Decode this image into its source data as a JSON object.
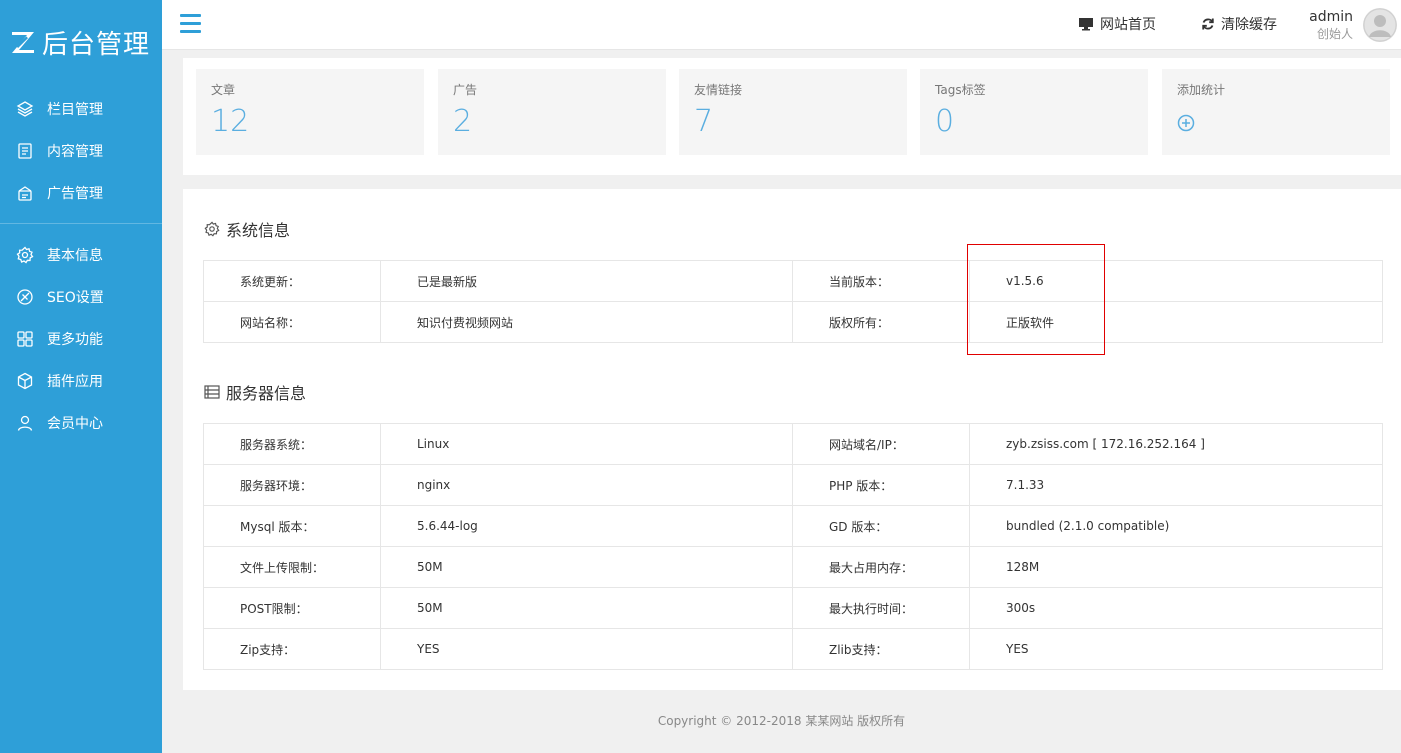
{
  "sidebar": {
    "logo_text": "后台管理",
    "groups": [
      [
        {
          "label": "栏目管理",
          "icon": "layers-icon"
        },
        {
          "label": "内容管理",
          "icon": "document-icon"
        },
        {
          "label": "广告管理",
          "icon": "ad-icon"
        }
      ],
      [
        {
          "label": "基本信息",
          "icon": "gear-icon"
        },
        {
          "label": "SEO设置",
          "icon": "seo-icon"
        },
        {
          "label": "更多功能",
          "icon": "grid-icon"
        },
        {
          "label": "插件应用",
          "icon": "cube-icon"
        },
        {
          "label": "会员中心",
          "icon": "user-icon"
        }
      ]
    ]
  },
  "header": {
    "site_home": "网站首页",
    "clear_cache": "清除缓存",
    "user_name": "admin",
    "user_role": "创始人"
  },
  "stats": [
    {
      "label": "文章",
      "value": "12"
    },
    {
      "label": "广告",
      "value": "2"
    },
    {
      "label": "友情链接",
      "value": "7"
    },
    {
      "label": "Tags标签",
      "value": "0"
    },
    {
      "label": "添加统计",
      "value": ""
    }
  ],
  "system_info": {
    "title": "系统信息",
    "rows": [
      [
        "系统更新：",
        "已是最新版",
        "当前版本：",
        "v1.5.6"
      ],
      [
        "网站名称：",
        "知识付费视频网站",
        "版权所有：",
        "正版软件"
      ]
    ]
  },
  "server_info": {
    "title": "服务器信息",
    "rows": [
      [
        "服务器系统：",
        "Linux",
        "网站域名/IP：",
        "zyb.zsiss.com [ 172.16.252.164 ]"
      ],
      [
        "服务器环境：",
        "nginx",
        "PHP 版本：",
        "7.1.33"
      ],
      [
        "Mysql 版本：",
        "5.6.44-log",
        "GD 版本：",
        "bundled (2.1.0 compatible)"
      ],
      [
        "文件上传限制：",
        "50M",
        "最大占用内存：",
        "128M"
      ],
      [
        "POST限制：",
        "50M",
        "最大执行时间：",
        "300s"
      ],
      [
        "Zip支持：",
        "YES",
        "Zlib支持：",
        "YES"
      ]
    ]
  },
  "footer": "Copyright © 2012-2018 某某网站 版权所有",
  "colors": {
    "sidebar": "#2e9fd8",
    "accent": "#5aaee0",
    "highlight": "#e00000"
  }
}
